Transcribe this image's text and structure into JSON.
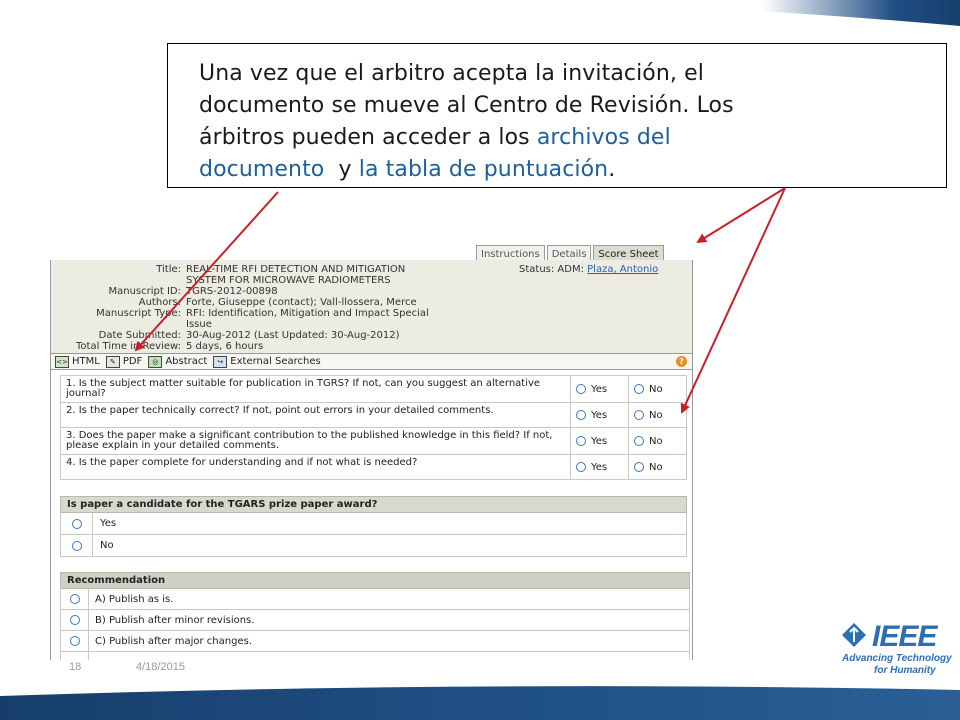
{
  "slide": {
    "callout": {
      "line1": "Una vez que el arbitro acepta la invitación, el",
      "line2": "documento se mueve al Centro de Revisión.  Los",
      "line3a": "árbitros pueden acceder a los ",
      "line3b": "archivos del",
      "line4a": "documento",
      "line4b": "  y ",
      "line4c": "la tabla de puntuación",
      "line4d": "."
    },
    "footer": {
      "page_number": "18",
      "date": "4/18/2015"
    },
    "logo": {
      "word": "IEEE",
      "tagline1": "Advancing Technology",
      "tagline2": "for Humanity"
    },
    "colors": {
      "band": "#1f4f84",
      "highlight": "#1d5f9a",
      "arrow": "#c8202a",
      "logo": "#2b70b6"
    }
  },
  "app": {
    "tabs": [
      "Instructions",
      "Details",
      "Score Sheet"
    ],
    "active_tab": "Score Sheet",
    "meta": {
      "title_key": "Title:",
      "title_val1": "REAL-TIME RFI DETECTION AND MITIGATION",
      "title_val2": "SYSTEM FOR MICROWAVE RADIOMETERS",
      "id_key": "Manuscript ID:",
      "id_val": "TGRS-2012-00898",
      "authors_key": "Authors:",
      "authors_val": "Forte, Giuseppe (contact); Vall-llossera, Merce",
      "type_key": "Manuscript Type:",
      "type_val1": "RFI: Identification, Mitigation and Impact Special",
      "type_val2": "Issue",
      "date_key": "Date Submitted:",
      "date_val": "30-Aug-2012 (Last Updated: 30-Aug-2012)",
      "time_key": "Total Time in Review:",
      "time_val": "5 days, 6 hours",
      "status_label": "Status: ADM:",
      "status_link": "Plaza, Antonio"
    },
    "toolbar": {
      "html": "HTML",
      "pdf": "PDF",
      "abstract": "Abstract",
      "external": "External Searches",
      "help": "?"
    },
    "questions": [
      {
        "text": "1. Is the subject matter suitable for publication in TGRS? If not, can you suggest an alternative journal?",
        "yes": "Yes",
        "no": "No"
      },
      {
        "text": "2. Is the paper technically correct? If not, point out errors in your detailed comments.",
        "yes": "Yes",
        "no": "No"
      },
      {
        "text": "3. Does the paper make a significant contribution to the published knowledge in this field? If not, please explain in your detailed comments.",
        "yes": "Yes",
        "no": "No"
      },
      {
        "text": "4. Is the paper complete for understanding and if not what is needed?",
        "yes": "Yes",
        "no": "No"
      }
    ],
    "prize": {
      "header": "Is paper a candidate for the TGARS prize paper award?",
      "options": [
        "Yes",
        "No"
      ]
    },
    "recommendation": {
      "header": "Recommendation",
      "options": [
        "A) Publish as is.",
        "B) Publish after minor revisions.",
        "C) Publish after major changes."
      ]
    }
  }
}
